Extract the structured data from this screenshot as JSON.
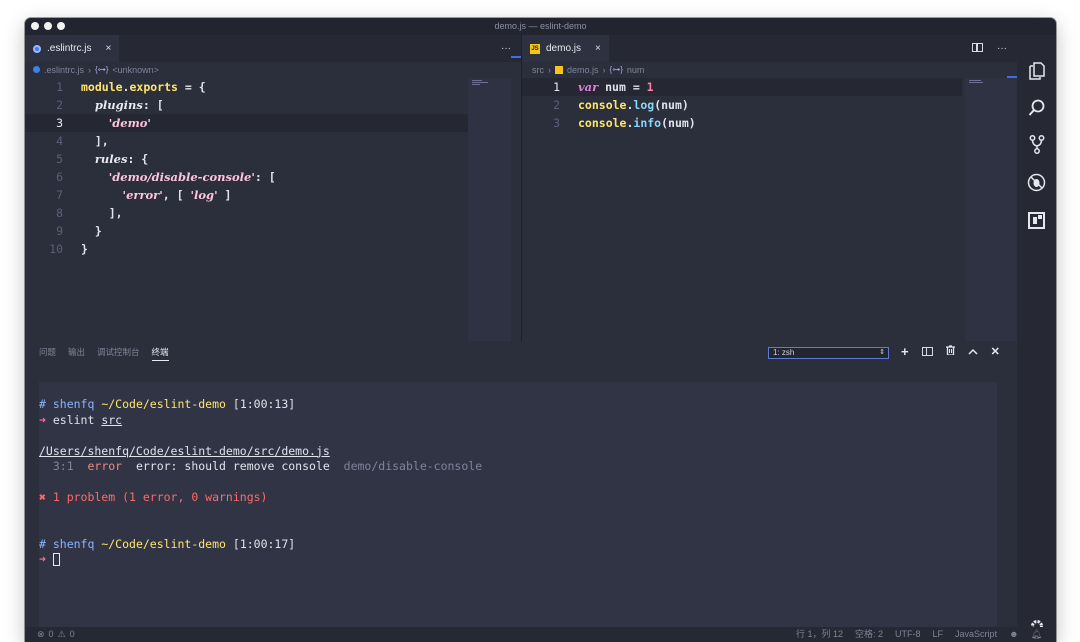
{
  "window": {
    "title": "demo.js — eslint-demo"
  },
  "left_editor": {
    "tab": {
      "label": ".eslintrc.js",
      "close": "×"
    },
    "tab_actions": {
      "more": "···"
    },
    "breadcrumb": {
      "file": ".eslintrc.js",
      "sep": "›",
      "symbol_icon": "{⊶}",
      "symbol": "<unknown>"
    },
    "lines": [
      {
        "n": "1",
        "parts": [
          [
            "module",
            "k-yellow"
          ],
          [
            ".",
            "k-plain"
          ],
          [
            "exports",
            "k-yellow"
          ],
          [
            " = {",
            "k-plain"
          ]
        ]
      },
      {
        "n": "2",
        "parts": [
          [
            "  ",
            "k-plain"
          ],
          [
            "plugins",
            "k-ital"
          ],
          [
            ": [",
            "k-plain"
          ]
        ]
      },
      {
        "n": "3",
        "parts": [
          [
            "    ",
            "k-plain"
          ],
          [
            "'demo'",
            "k-str"
          ]
        ],
        "current": true
      },
      {
        "n": "4",
        "parts": [
          [
            "  ],",
            "k-plain"
          ]
        ]
      },
      {
        "n": "5",
        "parts": [
          [
            "  ",
            "k-plain"
          ],
          [
            "rules",
            "k-ital"
          ],
          [
            ": {",
            "k-plain"
          ]
        ]
      },
      {
        "n": "6",
        "parts": [
          [
            "    ",
            "k-plain"
          ],
          [
            "'demo/disable-console'",
            "k-str"
          ],
          [
            ": [",
            "k-plain"
          ]
        ]
      },
      {
        "n": "7",
        "parts": [
          [
            "      ",
            "k-plain"
          ],
          [
            "'error'",
            "k-str"
          ],
          [
            ", [ ",
            "k-plain"
          ],
          [
            "'log'",
            "k-str"
          ],
          [
            " ]",
            "k-plain"
          ]
        ]
      },
      {
        "n": "8",
        "parts": [
          [
            "    ],",
            "k-plain"
          ]
        ]
      },
      {
        "n": "9",
        "parts": [
          [
            "  }",
            "k-plain"
          ]
        ]
      },
      {
        "n": "10",
        "parts": [
          [
            "}",
            "k-plain"
          ]
        ]
      }
    ]
  },
  "right_editor": {
    "tab": {
      "label": "demo.js",
      "close": "×"
    },
    "tab_actions": {
      "more": "···"
    },
    "breadcrumb": {
      "folder": "src",
      "sep": "›",
      "file": "demo.js",
      "symbol_icon": "{⊶}",
      "symbol": "num"
    },
    "lines": [
      {
        "n": "1",
        "parts": [
          [
            "var",
            "k-var"
          ],
          [
            " num = ",
            "k-plain"
          ],
          [
            "1",
            "k-num"
          ]
        ],
        "current": true
      },
      {
        "n": "2",
        "parts": [
          [
            "console",
            "k-yellow"
          ],
          [
            ".",
            "k-plain"
          ],
          [
            "log",
            "k-cyan"
          ],
          [
            "(num)",
            "k-plain"
          ]
        ]
      },
      {
        "n": "3",
        "parts": [
          [
            "console",
            "k-yellow"
          ],
          [
            ".",
            "k-plain"
          ],
          [
            "info",
            "k-cyan"
          ],
          [
            "(num)",
            "k-plain"
          ]
        ]
      }
    ]
  },
  "panel": {
    "tabs": [
      "问题",
      "输出",
      "调试控制台",
      "终端"
    ],
    "active_tab": 3,
    "terminal_select": "1: zsh",
    "terminal_lines": [
      [
        [
          "# ",
          "t-blue"
        ],
        [
          "shenfq ",
          "t-blue"
        ],
        [
          "~/Code/eslint-demo ",
          "t-yellow"
        ],
        [
          "[1:00:13]",
          ""
        ]
      ],
      [
        [
          "➜ ",
          "t-pink"
        ],
        [
          "eslint ",
          ""
        ],
        [
          "src",
          "t-underline"
        ]
      ],
      [
        [
          "",
          ""
        ]
      ],
      [
        [
          "/Users/shenfq/Code/eslint-demo/src/demo.js",
          "t-underline"
        ]
      ],
      [
        [
          "  3:1  ",
          "t-dim"
        ],
        [
          "error",
          "t-orange"
        ],
        [
          "  error: should remove console  ",
          ""
        ],
        [
          "demo/disable-console",
          "t-dim"
        ]
      ],
      [
        [
          "",
          ""
        ]
      ],
      [
        [
          "✖ 1 problem (1 error, 0 warnings)",
          "t-red"
        ]
      ],
      [
        [
          "",
          ""
        ]
      ],
      [
        [
          "",
          ""
        ]
      ],
      [
        [
          "# ",
          "t-blue"
        ],
        [
          "shenfq ",
          "t-blue"
        ],
        [
          "~/Code/eslint-demo ",
          "t-yellow"
        ],
        [
          "[1:00:17]",
          ""
        ]
      ],
      [
        [
          "➜ ",
          "t-pink"
        ],
        [
          "__CURSOR__",
          ""
        ]
      ]
    ]
  },
  "statusbar": {
    "errors": "0",
    "warnings": "0",
    "position": "行 1，列 12",
    "spaces": "空格: 2",
    "encoding": "UTF-8",
    "eol": "LF",
    "language": "JavaScript"
  },
  "icons": {
    "activity": [
      "files-icon",
      "search-icon",
      "source-control-icon",
      "debug-icon",
      "extensions-icon",
      "gear-icon"
    ],
    "accent": "#3c6fe0"
  }
}
